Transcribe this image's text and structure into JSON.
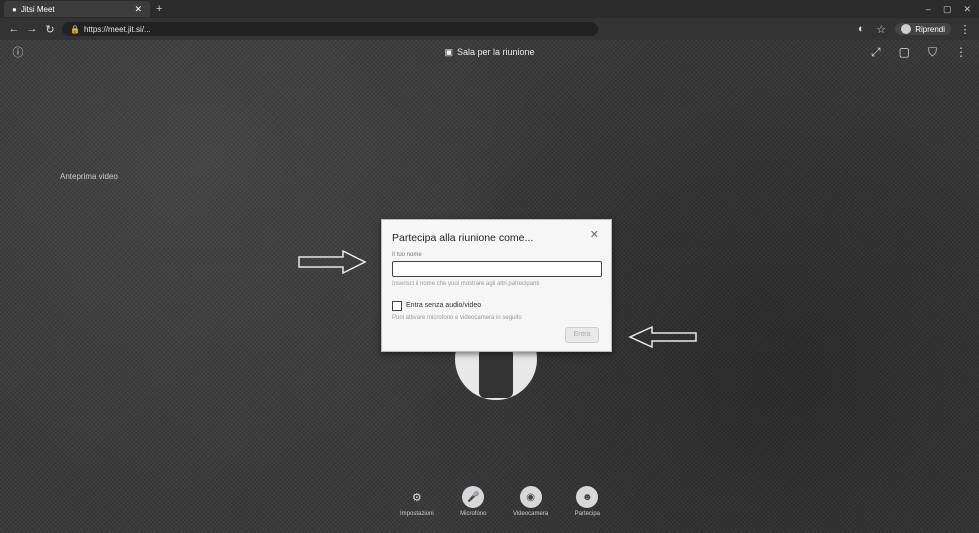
{
  "browser": {
    "tab_title": "Jitsi Meet",
    "new_tab_symbol": "+",
    "url": "https://meet.jit.si/...",
    "profile_label": "Riprendi",
    "window_controls": [
      "–",
      "▢",
      "✕"
    ]
  },
  "meeting": {
    "room_title": "Sala per la riunione",
    "side_text": "Anteprima video"
  },
  "dialog": {
    "title": "Partecipa alla riunione come...",
    "name_label": "Il tuo nome",
    "name_placeholder": "",
    "name_hint": "Inserisci il nome che vuoi mostrare agli altri partecipanti",
    "checkbox_label": "Entra senza audio/video",
    "checkbox_hint": "Puoi attivare microfono e videocamera in seguito",
    "join_label": "Entra"
  },
  "toolbar": {
    "items": [
      {
        "label": "Impostazioni",
        "icon": "settings-icon"
      },
      {
        "label": "Microfono",
        "icon": "microphone-icon"
      },
      {
        "label": "Videocamera",
        "icon": "camera-icon"
      },
      {
        "label": "Partecipa",
        "icon": "participant-icon"
      }
    ]
  }
}
